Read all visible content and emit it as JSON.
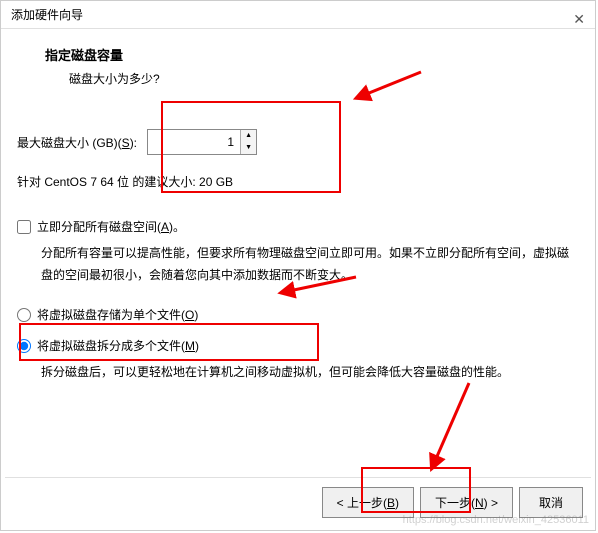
{
  "window": {
    "title": "添加硬件向导"
  },
  "heading": "指定磁盘容量",
  "subheading": "磁盘大小为多少?",
  "sizeRow": {
    "label": "最大磁盘大小 (GB)(",
    "mnemonic": "S",
    "labelEnd": "):",
    "value": "1"
  },
  "recommend": "针对 CentOS 7 64 位 的建议大小: 20 GB",
  "allocNow": {
    "label": "立即分配所有磁盘空间(",
    "mnemonic": "A",
    "labelEnd": ")。"
  },
  "allocDesc": "分配所有容量可以提高性能，但要求所有物理磁盘空间立即可用。如果不立即分配所有空间，虚拟磁盘的空间最初很小，会随着您向其中添加数据而不断变大。",
  "radioSingle": {
    "label": "将虚拟磁盘存储为单个文件(",
    "mnemonic": "O",
    "labelEnd": ")"
  },
  "radioMulti": {
    "label": "将虚拟磁盘拆分成多个文件(",
    "mnemonic": "M",
    "labelEnd": ")"
  },
  "splitDesc": "拆分磁盘后，可以更轻松地在计算机之间移动虚拟机，但可能会降低大容量磁盘的性能。",
  "buttons": {
    "back": "< 上一步(",
    "backM": "B",
    "backEnd": ")",
    "next": "下一步(",
    "nextM": "N",
    "nextEnd": ") >",
    "cancel": "取消"
  },
  "watermark": "https://blog.csdn.net/weixin_42536011"
}
